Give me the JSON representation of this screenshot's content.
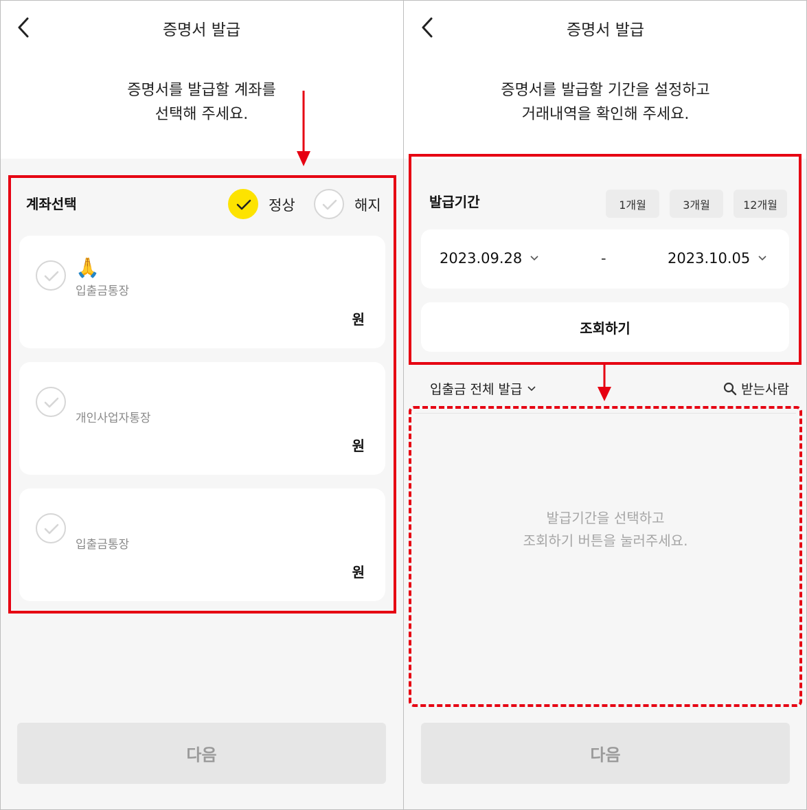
{
  "left": {
    "header_title": "증명서 발급",
    "instruction_line1": "증명서를 발급할 계좌를",
    "instruction_line2": "선택해 주세요.",
    "section_title": "계좌선택",
    "filter_normal": "정상",
    "filter_closed": "해지",
    "accounts": [
      {
        "emoji": "🙏",
        "name": "입출금통장",
        "unit": "원"
      },
      {
        "name": "개인사업자통장",
        "unit": "원"
      },
      {
        "name": "입출금통장",
        "unit": "원"
      }
    ],
    "next_label": "다음"
  },
  "right": {
    "header_title": "증명서 발급",
    "instruction_line1": "증명서를 발급할 기간을 설정하고",
    "instruction_line2": "거래내역을 확인해 주세요.",
    "section_title": "발급기간",
    "period_options": [
      "1개월",
      "3개월",
      "12개월"
    ],
    "start_date": "2023.09.28",
    "date_separator": "-",
    "end_date": "2023.10.05",
    "search_label": "조회하기",
    "filter_label": "입출금 전체 발급",
    "recipient_label": "받는사람",
    "empty_line1": "발급기간을 선택하고",
    "empty_line2": "조회하기 버튼을 눌러주세요.",
    "next_label": "다음"
  },
  "colors": {
    "accent_yellow": "#fde300",
    "annotation_red": "#e60012",
    "background_gray": "#f6f6f6",
    "disabled_button": "#e6e6e6"
  },
  "icons": [
    "chevron-left-icon",
    "check-icon",
    "chevron-down-icon",
    "search-icon",
    "arrow-down-icon"
  ]
}
